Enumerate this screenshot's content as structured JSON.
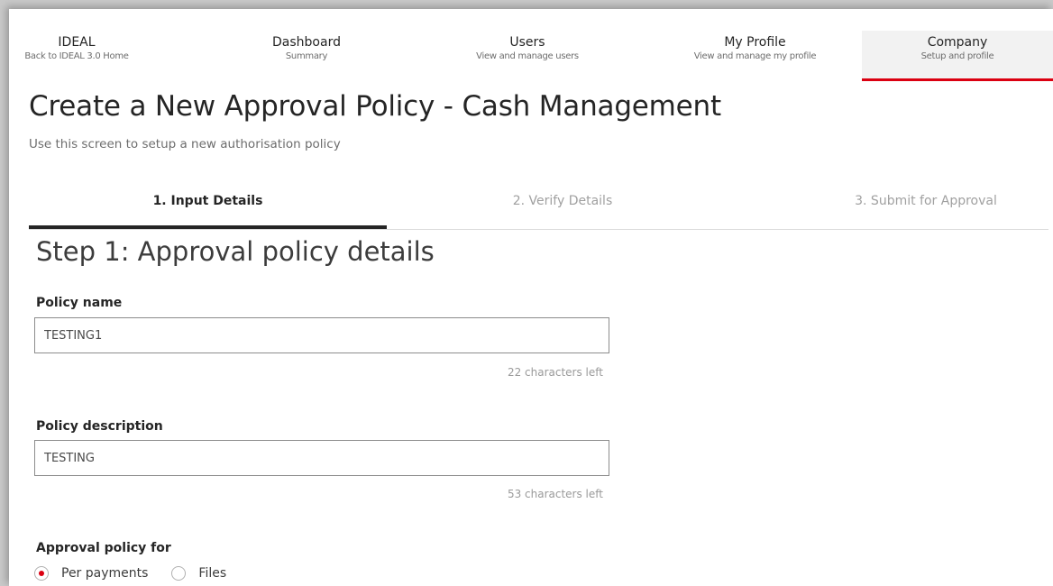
{
  "nav": {
    "items": [
      {
        "title": "IDEAL",
        "subtitle": "Back to IDEAL 3.0 Home"
      },
      {
        "title": "Dashboard",
        "subtitle": "Summary"
      },
      {
        "title": "Users",
        "subtitle": "View and manage users"
      },
      {
        "title": "My Profile",
        "subtitle": "View and manage my profile"
      },
      {
        "title": "Company",
        "subtitle": "Setup and profile"
      }
    ],
    "active_index": 4,
    "accent_color": "#db0011"
  },
  "page": {
    "title": "Create a New Approval Policy - Cash Management",
    "subtitle": "Use this screen to setup a new authorisation policy"
  },
  "steps": {
    "items": [
      {
        "label": "1. Input Details"
      },
      {
        "label": "2. Verify Details"
      },
      {
        "label": "3. Submit for Approval"
      }
    ],
    "active_index": 0
  },
  "step_heading": "Step 1: Approval policy details",
  "form": {
    "policy_name": {
      "label": "Policy name",
      "value": "TESTING1",
      "chars_left": "22 characters left"
    },
    "policy_description": {
      "label": "Policy description",
      "value": "TESTING",
      "chars_left": "53 characters left"
    },
    "approval_for": {
      "label": "Approval policy for",
      "options": [
        {
          "label": "Per payments",
          "checked": true
        },
        {
          "label": "Files",
          "checked": false
        }
      ]
    }
  }
}
